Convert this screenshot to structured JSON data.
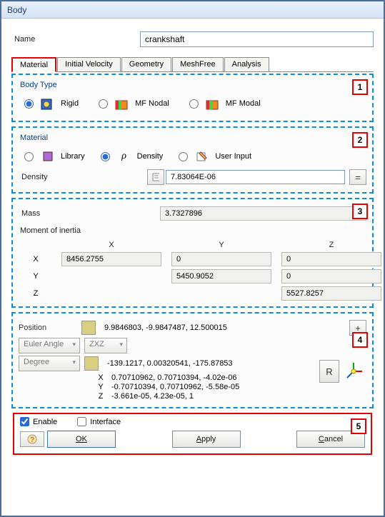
{
  "window": {
    "title": "Body"
  },
  "name": {
    "label": "Name",
    "value": "crankshaft"
  },
  "tabs": {
    "items": [
      {
        "label": "Material",
        "active": true
      },
      {
        "label": "Initial Velocity"
      },
      {
        "label": "Geometry"
      },
      {
        "label": "MeshFree"
      },
      {
        "label": "Analysis"
      }
    ]
  },
  "callouts": {
    "box1": "1",
    "box2": "2",
    "box3": "3",
    "box4": "4",
    "box5": "5"
  },
  "bodytype": {
    "header": "Body Type",
    "options": {
      "rigid": "Rigid",
      "mfnodal": "MF Nodal",
      "mfmodal": "MF Modal"
    },
    "selected": "rigid"
  },
  "material": {
    "header": "Material",
    "options": {
      "library": "Library",
      "density": "Density",
      "userinput": "User Input"
    },
    "selected": "density",
    "density_label": "Density",
    "density_value": "7.83064E-06"
  },
  "mass": {
    "label": "Mass",
    "value": "3.7327896",
    "moi_header": "Moment of inertia",
    "axes": {
      "x": "X",
      "y": "Y",
      "z": "Z"
    },
    "xx": "8456.2755",
    "xy": "0",
    "xz": "0",
    "yy": "5450.9052",
    "yz": "0",
    "zz": "5527.8257"
  },
  "position": {
    "label": "Position",
    "value": "9.9846803, -9.9847487, 12.500015",
    "euler_label": "Euler Angle",
    "euler_order": "ZXZ",
    "unit_label": "Degree",
    "euler_value": "-139.1217, 0.00320541, -175.87853",
    "rows": {
      "x": "0.70710962, 0.70710394, -4.02e-06",
      "y": "-0.70710394, 0.70710962, -5.58e-05",
      "z": "-3.661e-05, 4.23e-05, 1"
    },
    "r_label": "R"
  },
  "bottom": {
    "enable": "Enable",
    "interface": "Interface",
    "ok": "OK",
    "apply": "Apply",
    "cancel": "Cancel"
  }
}
